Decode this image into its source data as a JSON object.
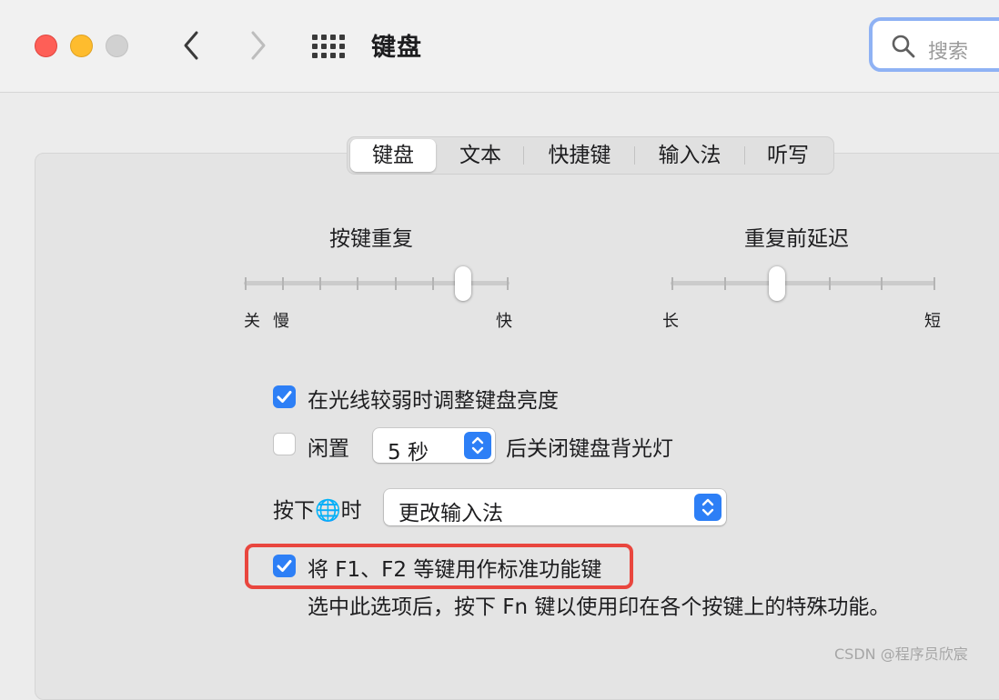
{
  "window": {
    "title": "键盘",
    "search_placeholder": "搜索"
  },
  "tabs": [
    {
      "label": "键盘",
      "active": true
    },
    {
      "label": "文本",
      "active": false
    },
    {
      "label": "快捷键",
      "active": false
    },
    {
      "label": "输入法",
      "active": false
    },
    {
      "label": "听写",
      "active": false
    }
  ],
  "key_repeat": {
    "title": "按键重复",
    "labels": {
      "off": "关",
      "slow": "慢",
      "fast": "快"
    },
    "level": 0.83
  },
  "repeat_delay": {
    "title": "重复前延迟",
    "labels": {
      "long": "长",
      "short": "短"
    },
    "level": 0.4
  },
  "options": {
    "adjust_brightness": {
      "label": "在光线较弱时调整键盘亮度",
      "checked": true
    },
    "idle_backlight": {
      "label_before": "闲置",
      "value": "5 秒",
      "label_after": "后关闭键盘背光灯",
      "checked": false
    },
    "globe_key": {
      "label": "按下🌐时",
      "value": "更改输入法"
    },
    "fn_keys": {
      "label": "将 F1、F2 等键用作标准功能键",
      "checked": true,
      "description": "选中此选项后，按下 Fn 键以使用印在各个按键上的特殊功能。"
    }
  },
  "watermark": "CSDN @程序员欣宸",
  "colors": {
    "accent": "#2d7ff6",
    "highlight_border": "#e9463e",
    "close": "#fe5f57",
    "minimize": "#febc2e"
  }
}
